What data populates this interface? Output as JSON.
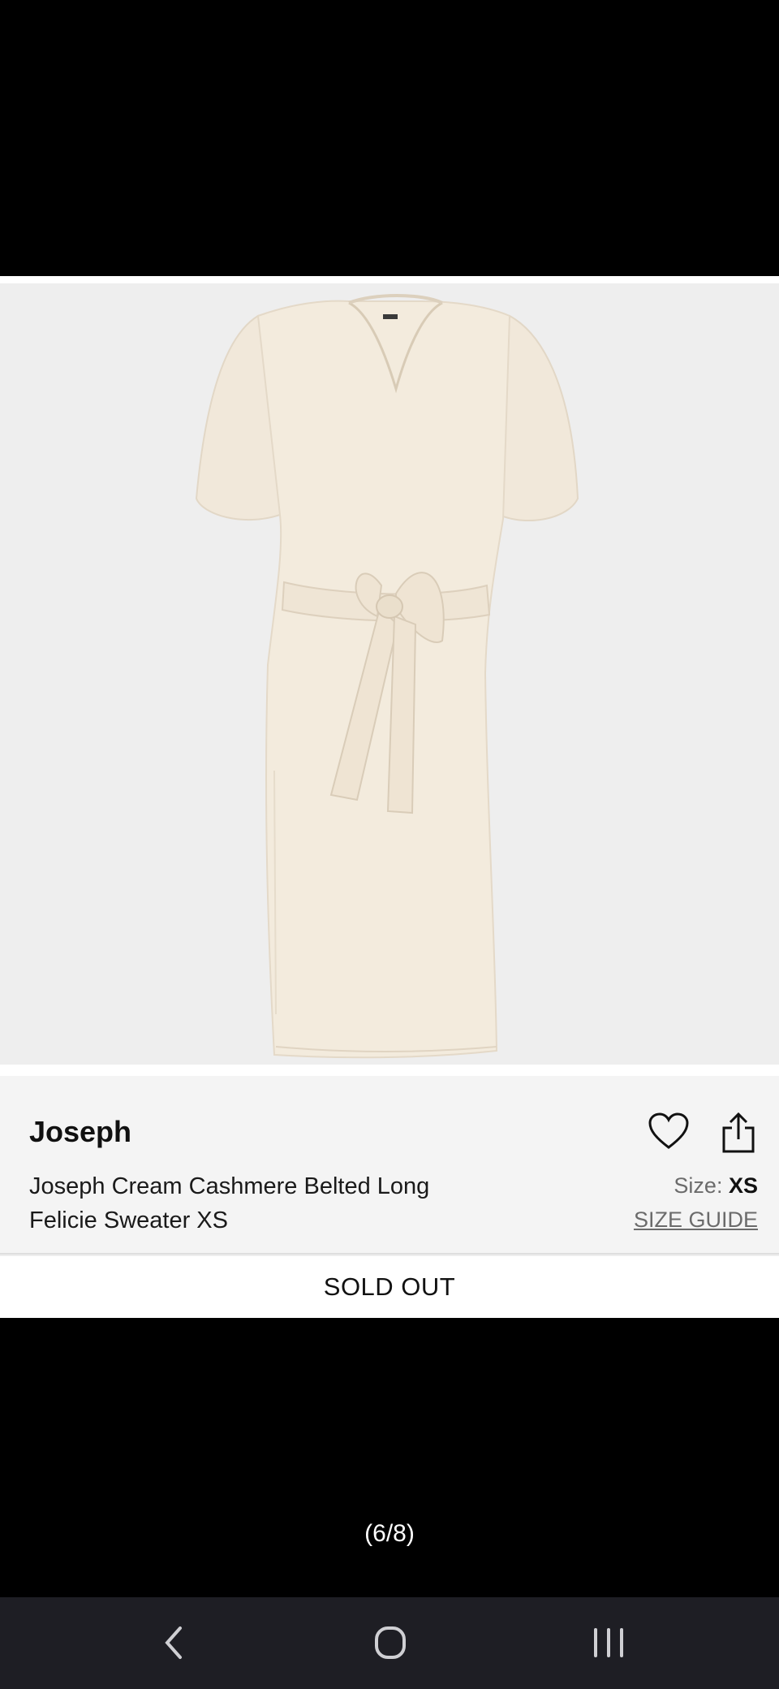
{
  "product": {
    "brand": "Joseph",
    "title_line1": "Joseph Cream Cashmere Belted Long",
    "title_line2": "Felicie Sweater XS",
    "size_label": "Size:",
    "size_value": "XS",
    "size_guide": "SIZE GUIDE",
    "status": "SOLD OUT"
  },
  "gallery": {
    "counter": "(6/8)",
    "dot_count": 2,
    "active_dot": 1
  },
  "icons": {
    "favorite": "heart-icon",
    "share": "share-icon",
    "back": "back-chevron-icon",
    "home": "home-icon",
    "recents": "recents-icon"
  },
  "colors": {
    "image_bg": "#eeeeee",
    "panel_bg": "#f4f4f4",
    "garment": "#f3ebdd",
    "navbar_bg": "#1e1e24"
  }
}
